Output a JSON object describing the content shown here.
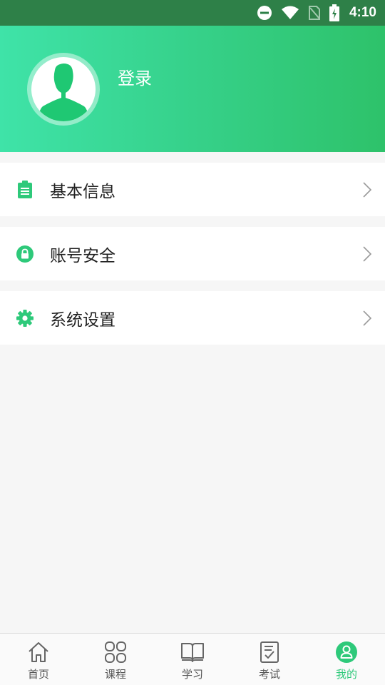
{
  "status_bar": {
    "time": "4:10",
    "icons": [
      "do-not-disturb-icon",
      "wifi-icon",
      "no-sim-icon",
      "battery-charging-icon"
    ]
  },
  "profile": {
    "login_label": "登录",
    "avatar_icon": "person-silhouette-icon"
  },
  "menu": [
    {
      "label": "基本信息",
      "icon": "clipboard-icon"
    },
    {
      "label": "账号安全",
      "icon": "lock-icon"
    },
    {
      "label": "系统设置",
      "icon": "gear-icon"
    }
  ],
  "tabbar": {
    "items": [
      {
        "label": "首页",
        "icon": "home-icon",
        "active": false
      },
      {
        "label": "课程",
        "icon": "grid-icon",
        "active": false
      },
      {
        "label": "学习",
        "icon": "book-icon",
        "active": false
      },
      {
        "label": "考试",
        "icon": "exam-icon",
        "active": false
      },
      {
        "label": "我的",
        "icon": "profile-icon",
        "active": true
      }
    ]
  },
  "colors": {
    "accent": "#2ec97a",
    "status_bar": "#2e8048",
    "header_start": "#3fe3a8",
    "header_end": "#2ec26a"
  }
}
